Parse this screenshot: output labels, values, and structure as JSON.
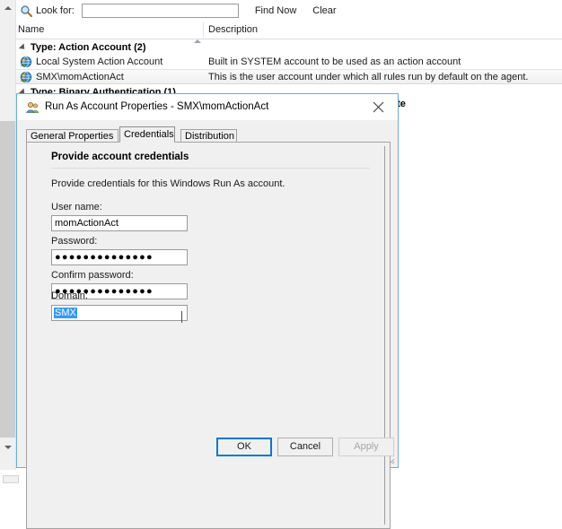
{
  "console": {
    "search": {
      "icon": "search-icon",
      "label": "Look for:",
      "value": "",
      "placeholder": "",
      "find_now_label": "Find Now",
      "clear_label": "Clear"
    },
    "columns": {
      "name": "Name",
      "description": "Description",
      "sort_indicator": "sort-ascending-icon"
    },
    "groups": [
      {
        "label": "Type: Action Account (2)",
        "rows": [
          {
            "icon": "run-as-account-icon",
            "name": "Local System Action Account",
            "description": "Built in SYSTEM account to be used as an action account",
            "selected": false
          },
          {
            "icon": "run-as-account-icon",
            "name": "SMX\\momActionAct",
            "description": "This is the user account under which all rules run by default on the agent.",
            "selected": true
          }
        ]
      },
      {
        "label": "Type: Binary Authentication (1)",
        "rows": []
      }
    ],
    "obscured_text": "ate",
    "scrollbar": {
      "up_icon": "scroll-up-icon",
      "down_icon": "scroll-down-icon"
    }
  },
  "dialog": {
    "icon": "run-as-account-icon",
    "title": "Run As Account Properties - SMX\\momActionAct",
    "close_icon": "close-icon",
    "tabs": [
      {
        "label": "General Properties",
        "active": false
      },
      {
        "label": "Credentials",
        "active": true
      },
      {
        "label": "Distribution",
        "active": false
      }
    ],
    "credentials": {
      "heading": "Provide account credentials",
      "description": "Provide credentials for this Windows Run As account.",
      "fields": [
        {
          "label": "User name:",
          "value": "momActionAct",
          "type": "text"
        },
        {
          "label": "Password:",
          "value": "●●●●●●●●●●●●●●",
          "type": "password"
        },
        {
          "label": "Confirm password:",
          "value": "●●●●●●●●●●●●●●",
          "type": "password"
        }
      ],
      "domain": {
        "label": "Domain:",
        "value": "SMX",
        "arrow_icon": "chevron-down-icon",
        "selected": true
      }
    },
    "buttons": {
      "ok": "OK",
      "cancel": "Cancel",
      "apply": "Apply"
    }
  },
  "colors": {
    "accent": "#0078d7",
    "selection": "#3399ff",
    "dialog_border": "#6aaedd",
    "window_bg": "#f0f0f0"
  }
}
